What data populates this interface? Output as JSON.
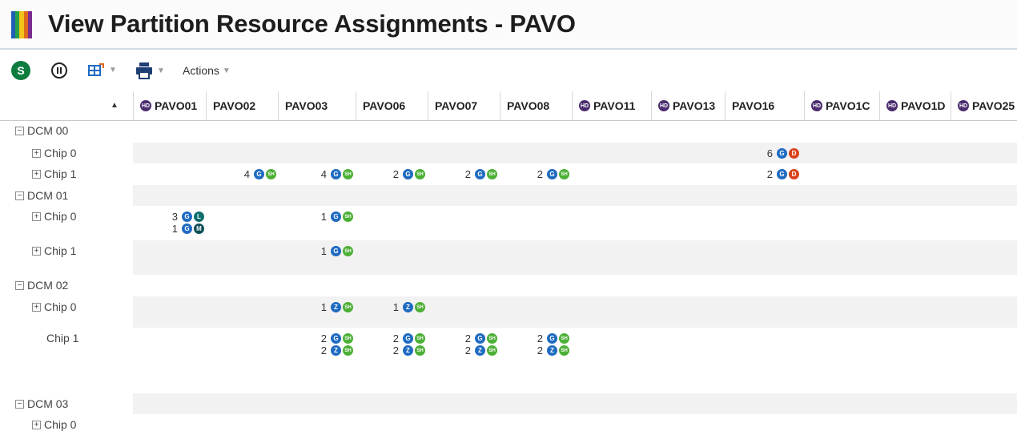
{
  "window": {
    "title": "View Partition Resource Assignments - PAVO",
    "logo_colors": [
      "#1f5fb4",
      "#27a04a",
      "#f2c318",
      "#e06a1b",
      "#7a2d8e"
    ]
  },
  "toolbar": {
    "start_icon_letter": "S",
    "actions_label": "Actions",
    "icons": [
      "start-icon",
      "pause-icon",
      "export-icon",
      "print-icon"
    ]
  },
  "columns": [
    {
      "label": "PAVO01",
      "hd": true
    },
    {
      "label": "PAVO02",
      "hd": false
    },
    {
      "label": "PAVO03",
      "hd": false
    },
    {
      "label": "PAVO06",
      "hd": false
    },
    {
      "label": "PAVO07",
      "hd": false
    },
    {
      "label": "PAVO08",
      "hd": false
    },
    {
      "label": "PAVO11",
      "hd": true
    },
    {
      "label": "PAVO13",
      "hd": true
    },
    {
      "label": "PAVO16",
      "hd": false
    },
    {
      "label": "PAVO1C",
      "hd": true
    },
    {
      "label": "PAVO1D",
      "hd": true
    },
    {
      "label": "PAVO25",
      "hd": true
    }
  ],
  "hd_badge_text": "HD",
  "rows": [
    {
      "label": "DCM 00",
      "level": 0,
      "toggle": "−",
      "shaded": false,
      "cells": {}
    },
    {
      "label": "Chip 0",
      "level": 1,
      "toggle": "+",
      "shaded": true,
      "cells": {
        "8": [
          {
            "num": "6",
            "badges": [
              "G",
              "D"
            ]
          }
        ]
      }
    },
    {
      "label": "Chip 1",
      "level": 1,
      "toggle": "+",
      "shaded": false,
      "cells": {
        "1": [
          {
            "num": "4",
            "badges": [
              "G",
              "SH"
            ]
          }
        ],
        "2": [
          {
            "num": "4",
            "badges": [
              "G",
              "SH"
            ]
          }
        ],
        "3": [
          {
            "num": "2",
            "badges": [
              "G",
              "SH"
            ]
          }
        ],
        "4": [
          {
            "num": "2",
            "badges": [
              "G",
              "SH"
            ]
          }
        ],
        "5": [
          {
            "num": "2",
            "badges": [
              "G",
              "SH"
            ]
          }
        ],
        "8": [
          {
            "num": "2",
            "badges": [
              "G",
              "D"
            ]
          }
        ]
      }
    },
    {
      "label": "DCM 01",
      "level": 0,
      "toggle": "−",
      "shaded": true,
      "cells": {}
    },
    {
      "label": "Chip 0",
      "level": 1,
      "toggle": "+",
      "shaded": false,
      "cells": {
        "0": [
          {
            "num": "3",
            "badges": [
              "G",
              "L"
            ]
          },
          {
            "num": "1",
            "badges": [
              "G",
              "M"
            ]
          }
        ],
        "2": [
          {
            "num": "1",
            "badges": [
              "G",
              "SH"
            ]
          }
        ]
      }
    },
    {
      "label": "Chip 1",
      "level": 1,
      "toggle": "+",
      "shaded": true,
      "cells": {
        "2": [
          {
            "num": "1",
            "badges": [
              "G",
              "SH"
            ]
          }
        ]
      }
    },
    {
      "label": "DCM 02",
      "level": 0,
      "toggle": "−",
      "shaded": false,
      "cells": {}
    },
    {
      "label": "Chip 0",
      "level": 1,
      "toggle": "+",
      "shaded": true,
      "cells": {
        "2": [
          {
            "num": "1",
            "badges": [
              "Z",
              "SH"
            ]
          }
        ],
        "3": [
          {
            "num": "1",
            "badges": [
              "Z",
              "SH"
            ]
          }
        ]
      }
    },
    {
      "label": "Chip 1",
      "level": 1,
      "toggle": "",
      "shaded": false,
      "cells": {
        "2": [
          {
            "num": "2",
            "badges": [
              "G",
              "SH"
            ]
          },
          {
            "num": "2",
            "badges": [
              "Z",
              "SH"
            ]
          }
        ],
        "3": [
          {
            "num": "2",
            "badges": [
              "G",
              "SH"
            ]
          },
          {
            "num": "2",
            "badges": [
              "Z",
              "SH"
            ]
          }
        ],
        "4": [
          {
            "num": "2",
            "badges": [
              "G",
              "SH"
            ]
          },
          {
            "num": "2",
            "badges": [
              "Z",
              "SH"
            ]
          }
        ],
        "5": [
          {
            "num": "2",
            "badges": [
              "G",
              "SH"
            ]
          },
          {
            "num": "2",
            "badges": [
              "Z",
              "SH"
            ]
          }
        ]
      }
    },
    {
      "label": "DCM 03",
      "level": 0,
      "toggle": "−",
      "shaded": true,
      "cells": {}
    },
    {
      "label": "Chip 0",
      "level": 1,
      "toggle": "+",
      "shaded": false,
      "cells": {}
    }
  ]
}
